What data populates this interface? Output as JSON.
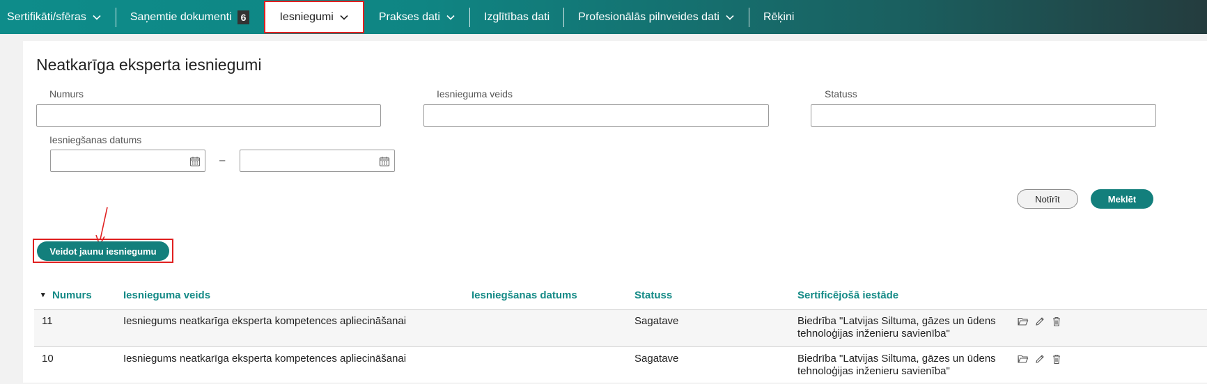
{
  "nav": {
    "items": [
      {
        "label": "Sertifikāti/sfēras",
        "dropdown": true
      },
      {
        "label": "Saņemtie dokumenti",
        "badge": "6"
      },
      {
        "label": "Iesniegumi",
        "dropdown": true,
        "active": true
      },
      {
        "label": "Prakses dati",
        "dropdown": true
      },
      {
        "label": "Izglītības dati"
      },
      {
        "label": "Profesionālās pilnveides dati",
        "dropdown": true
      },
      {
        "label": "Rēķini"
      }
    ]
  },
  "page": {
    "title": "Neatkarīga eksperta iesniegumi"
  },
  "filters": {
    "number_label": "Numurs",
    "number_value": "",
    "type_label": "Iesnieguma veids",
    "type_value": "",
    "status_label": "Statuss",
    "status_value": "",
    "date_label": "Iesniegšanas datums",
    "date_from": "",
    "date_to": "",
    "date_separator": "–",
    "clear_label": "Notīrīt",
    "search_label": "Meklēt"
  },
  "create_button_label": "Veidot jaunu iesniegumu",
  "table": {
    "sort_indicator": "▾",
    "columns": [
      "Numurs",
      "Iesnieguma veids",
      "Iesniegšanas datums",
      "Statuss",
      "Sertificējošā iestāde"
    ],
    "rows": [
      {
        "number": "11",
        "type": "Iesniegums neatkarīga eksperta kompetences apliecināšanai",
        "date": "",
        "status": "Sagatave",
        "authority_line1": "Biedrība \"Latvijas Siltuma, gāzes un ūdens",
        "authority_line2": "tehnoloģijas inženieru savienība\""
      },
      {
        "number": "10",
        "type": "Iesniegums neatkarīga eksperta kompetences apliecināšanai",
        "date": "",
        "status": "Sagatave",
        "authority_line1": "Biedrība \"Latvijas Siltuma, gāzes un ūdens",
        "authority_line2": "tehnoloģijas inženieru savienība\""
      }
    ]
  },
  "colors": {
    "primary": "#137f7c",
    "header_text": "#148a86",
    "highlight": "#e02020"
  }
}
